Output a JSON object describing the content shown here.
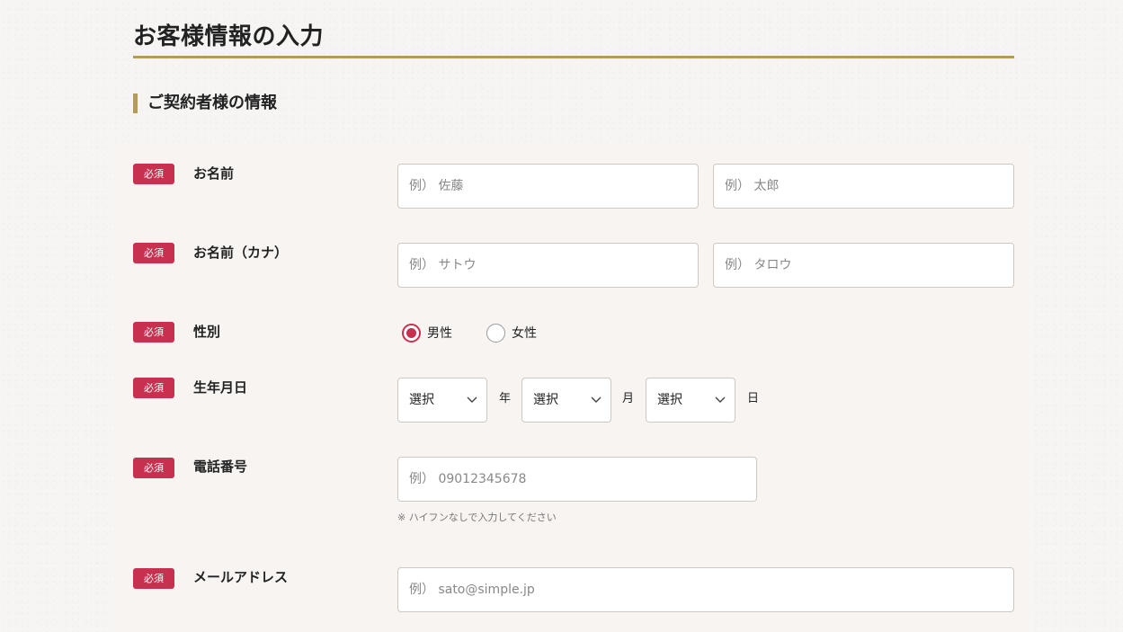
{
  "page": {
    "title": "お客様情報の入力"
  },
  "section": {
    "heading": "ご契約者様の情報"
  },
  "required_badge": "必須",
  "fields": {
    "name": {
      "label": "お名前",
      "last_placeholder": "例） 佐藤",
      "first_placeholder": "例） 太郎"
    },
    "kana": {
      "label": "お名前（カナ）",
      "last_placeholder": "例） サトウ",
      "first_placeholder": "例） タロウ"
    },
    "gender": {
      "label": "性別",
      "options": [
        "男性",
        "女性"
      ],
      "selected": "男性"
    },
    "birthdate": {
      "label": "生年月日",
      "year": {
        "value": "選択",
        "unit": "年"
      },
      "month": {
        "value": "選択",
        "unit": "月"
      },
      "day": {
        "value": "選択",
        "unit": "日"
      }
    },
    "phone": {
      "label": "電話番号",
      "placeholder": "例） 09012345678",
      "hint": "※ ハイフンなしで入力してください"
    },
    "email": {
      "label": "メールアドレス",
      "placeholder": "例） sato@simple.jp"
    }
  },
  "colors": {
    "accent_gold": "#b49a5b",
    "badge_red": "#c8304f",
    "panel_bg": "#f8f4f2"
  },
  "icons": {
    "select_arrow": "chevron-down-icon"
  }
}
